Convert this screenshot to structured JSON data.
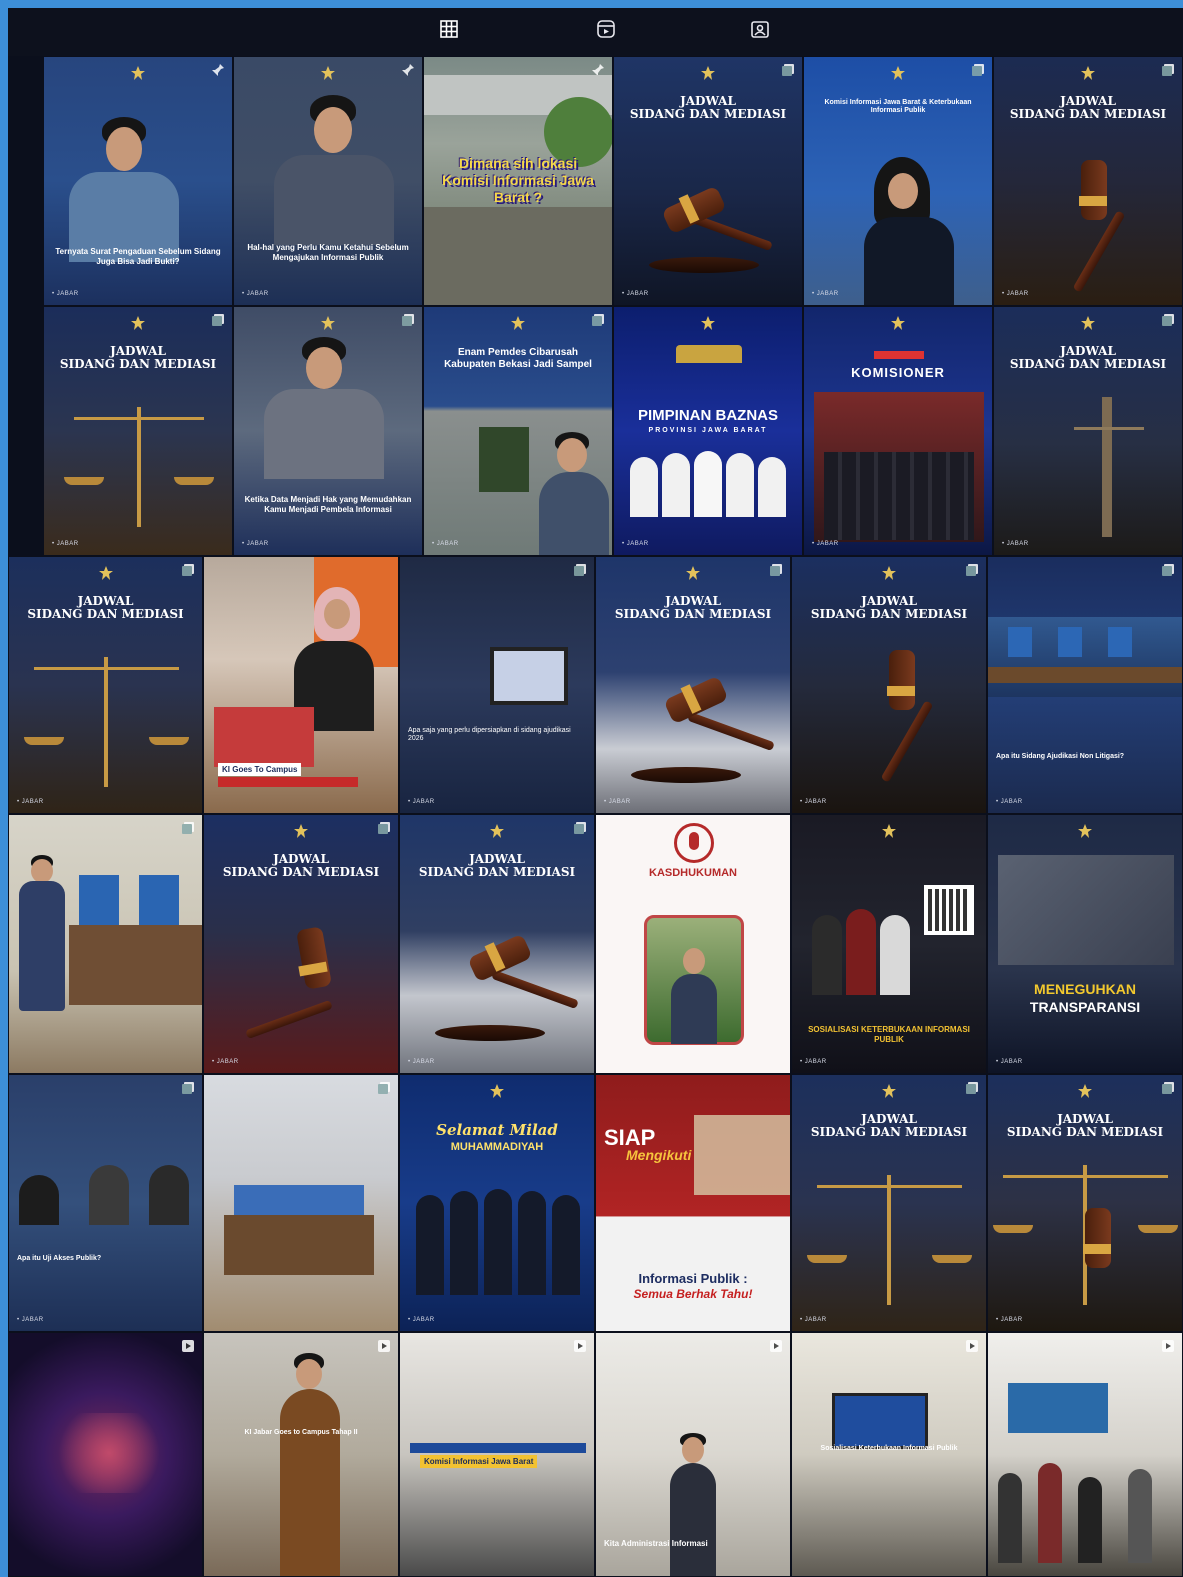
{
  "tabs": [
    {
      "name": "grid-tab",
      "icon": "grid-icon",
      "active": true
    },
    {
      "name": "reels-tab",
      "icon": "reels-icon",
      "active": false
    },
    {
      "name": "tagged-tab",
      "icon": "tagged-icon",
      "active": false
    }
  ],
  "common": {
    "jadwal_line1": "JADWAL",
    "jadwal_line2": "SIDANG DAN MEDIASI"
  },
  "top_posts": [
    {
      "caption": "Ternyata Surat Pengaduan Sebelum Sidang Juga Bisa Jadi Bukti?"
    },
    {
      "caption": "Hal-hal yang Perlu Kamu Ketahui Sebelum Mengajukan Informasi Publik"
    },
    {
      "title": "Dimana sih lokasi Komisi Informasi Jawa Barat ?"
    },
    {},
    {
      "caption": "Komisi Informasi Jawa Barat & Keterbukaan Informasi Publik"
    },
    {},
    {},
    {
      "caption": "Ketika Data Menjadi Hak yang Memudahkan Kamu Menjadi Pembela Informasi"
    },
    {
      "title": "Enam Pemdes Cibarusah Kabupaten Bekasi Jadi Sampel"
    },
    {
      "title": "PIMPINAN BAZNAS",
      "subtitle": "PROVINSI JAWA BARAT"
    },
    {
      "title": "KOMISIONER"
    },
    {}
  ],
  "main_posts": [
    {},
    {
      "caption": "KI Goes To Campus"
    },
    {
      "caption": "Apa saja yang perlu dipersiapkan di sidang ajudikasi 2026"
    },
    {},
    {},
    {
      "caption": "Apa itu Sidang Ajudikasi Non Litigasi?"
    },
    {},
    {},
    {},
    {
      "title": "KASDHUKUMAN"
    },
    {
      "title": "SOSIALISASI KETERBUKAAN INFORMASI PUBLIK"
    },
    {
      "title": "MENEGUHKAN",
      "subtitle": "TRANSPARANSI"
    },
    {
      "caption": "Apa itu Uji Akses Publik?"
    },
    {},
    {
      "title": "Selamat Milad",
      "subtitle": "MUHAMMADIYAH"
    },
    {
      "title": "SIAP",
      "subtitle": "Mengikuti",
      "line2": "Informasi Publik :",
      "line3": "Semua Berhak Tahu!"
    },
    {},
    {},
    {},
    {
      "caption": "KI Jabar Goes to Campus Tahap II"
    },
    {
      "caption": "Komisi Informasi Jawa Barat"
    },
    {
      "caption": "Kita Administrasi Informasi"
    },
    {
      "caption": "Sosialisasi Keterbukaan Informasi Publik"
    },
    {}
  ]
}
